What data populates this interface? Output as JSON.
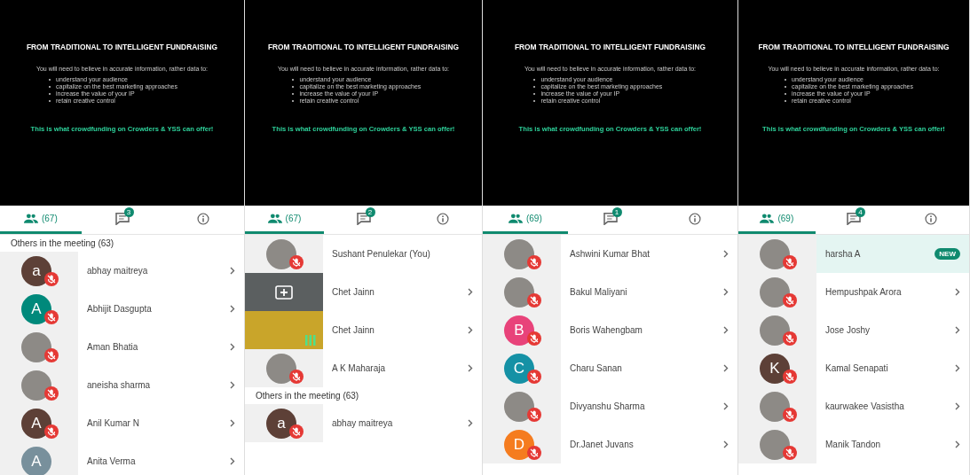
{
  "panels": [
    {
      "slide": {
        "title": "FROM TRADITIONAL TO INTELLIGENT FUNDRAISING",
        "intro": "You will need to believe in accurate information, rather data to:",
        "bullets": [
          "understand your audience",
          "capitalize on the best marketing approaches",
          "increase the value of your IP",
          "retain creative control"
        ],
        "tagline": "This is what crowdfunding on Crowders & YSS can offer!"
      },
      "tabs": [
        {
          "kind": "people",
          "count": "(67)",
          "selected": true
        },
        {
          "kind": "chat",
          "badge": "3",
          "selected": false
        },
        {
          "kind": "info",
          "selected": false
        }
      ],
      "items": [
        {
          "kind": "header",
          "text": "Others in the meeting (63)"
        },
        {
          "kind": "participant",
          "name": "abhay maitreya",
          "avatar": {
            "kind": "letter",
            "letter": "a",
            "color": "#5d4037"
          },
          "muted": true,
          "chevron": true,
          "highlighted": false
        },
        {
          "kind": "participant",
          "name": "Abhijit Dasgupta",
          "avatar": {
            "kind": "letter",
            "letter": "A",
            "color": "#00897b"
          },
          "muted": true,
          "chevron": true,
          "highlighted": false
        },
        {
          "kind": "participant",
          "name": "Aman Bhatia",
          "avatar": {
            "kind": "photo"
          },
          "muted": true,
          "chevron": true,
          "highlighted": false
        },
        {
          "kind": "participant",
          "name": "aneisha sharma",
          "avatar": {
            "kind": "photo"
          },
          "muted": true,
          "chevron": true,
          "highlighted": false
        },
        {
          "kind": "participant",
          "name": "Anil Kumar N",
          "avatar": {
            "kind": "letter",
            "letter": "A",
            "color": "#5d4037"
          },
          "muted": true,
          "chevron": true,
          "highlighted": false
        },
        {
          "kind": "participant",
          "name": "Anita Verma",
          "avatar": {
            "kind": "letter",
            "letter": "A",
            "color": "#78909c"
          },
          "muted": false,
          "chevron": true,
          "highlighted": false
        }
      ]
    },
    {
      "slide": {
        "title": "FROM TRADITIONAL TO INTELLIGENT FUNDRAISING",
        "intro": "You will need to believe in accurate information, rather data to:",
        "bullets": [
          "understand your audience",
          "capitalize on the best marketing approaches",
          "increase the value of your IP",
          "retain creative control"
        ],
        "tagline": "This is what crowdfunding on Crowders & YSS can offer!"
      },
      "tabs": [
        {
          "kind": "people",
          "count": "(67)",
          "selected": true
        },
        {
          "kind": "chat",
          "badge": "2",
          "selected": false
        },
        {
          "kind": "info",
          "selected": false
        }
      ],
      "items": [
        {
          "kind": "participant",
          "name": "Sushant Penulekar (You)",
          "avatar": {
            "kind": "photo"
          },
          "muted": true,
          "chevron": false,
          "highlighted": false
        },
        {
          "kind": "participant",
          "name": "Chet Jainn",
          "avatar": {
            "kind": "screen"
          },
          "muted": false,
          "chevron": true,
          "highlighted": false
        },
        {
          "kind": "participant",
          "name": "Chet Jainn",
          "avatar": {
            "kind": "video"
          },
          "muted": false,
          "chevron": true,
          "highlighted": false
        },
        {
          "kind": "participant",
          "name": "A K Maharaja",
          "avatar": {
            "kind": "photo"
          },
          "muted": true,
          "chevron": true,
          "highlighted": false
        },
        {
          "kind": "header",
          "text": "Others in the meeting (63)"
        },
        {
          "kind": "participant",
          "name": "abhay maitreya",
          "avatar": {
            "kind": "letter",
            "letter": "a",
            "color": "#5d4037"
          },
          "muted": true,
          "chevron": true,
          "highlighted": false
        }
      ]
    },
    {
      "slide": {
        "title": "FROM TRADITIONAL TO INTELLIGENT FUNDRAISING",
        "intro": "You will need to believe in accurate information, rather data to:",
        "bullets": [
          "understand your audience",
          "capitalize on the best marketing approaches",
          "increase the value of your IP",
          "retain creative control"
        ],
        "tagline": "This is what crowdfunding on Crowders & YSS can offer!"
      },
      "tabs": [
        {
          "kind": "people",
          "count": "(69)",
          "selected": true
        },
        {
          "kind": "chat",
          "badge": "1",
          "selected": false
        },
        {
          "kind": "info",
          "selected": false
        }
      ],
      "items": [
        {
          "kind": "participant",
          "name": "Ashwini Kumar Bhat",
          "avatar": {
            "kind": "photo"
          },
          "muted": true,
          "chevron": true,
          "highlighted": false
        },
        {
          "kind": "participant",
          "name": "Bakul Maliyani",
          "avatar": {
            "kind": "photo"
          },
          "muted": true,
          "chevron": true,
          "highlighted": false
        },
        {
          "kind": "participant",
          "name": "Boris Wahengbam",
          "avatar": {
            "kind": "letter",
            "letter": "B",
            "color": "#e8437a"
          },
          "muted": true,
          "chevron": true,
          "highlighted": false
        },
        {
          "kind": "participant",
          "name": "Charu Sanan",
          "avatar": {
            "kind": "letter",
            "letter": "C",
            "color": "#1591a5"
          },
          "muted": true,
          "chevron": true,
          "highlighted": false
        },
        {
          "kind": "participant",
          "name": "Divyanshu Sharma",
          "avatar": {
            "kind": "photo"
          },
          "muted": true,
          "chevron": true,
          "highlighted": false
        },
        {
          "kind": "participant",
          "name": "Dr.Janet Juvans",
          "avatar": {
            "kind": "letter",
            "letter": "D",
            "color": "#f57c1f"
          },
          "muted": true,
          "chevron": true,
          "highlighted": false
        }
      ]
    },
    {
      "slide": {
        "title": "FROM TRADITIONAL TO INTELLIGENT FUNDRAISING",
        "intro": "You will need to believe in accurate information, rather data to:",
        "bullets": [
          "understand your audience",
          "capitalize on the best marketing approaches",
          "increase the value of your IP",
          "retain creative control"
        ],
        "tagline": "This is what crowdfunding on Crowders & YSS can offer!"
      },
      "tabs": [
        {
          "kind": "people",
          "count": "(69)",
          "selected": true
        },
        {
          "kind": "chat",
          "badge": "4",
          "selected": false
        },
        {
          "kind": "info",
          "selected": false
        }
      ],
      "items": [
        {
          "kind": "participant",
          "name": "harsha A",
          "avatar": {
            "kind": "photo"
          },
          "muted": true,
          "chevron": false,
          "highlighted": true,
          "badge": "NEW"
        },
        {
          "kind": "participant",
          "name": "Hempushpak Arora",
          "avatar": {
            "kind": "photo"
          },
          "muted": true,
          "chevron": true,
          "highlighted": false
        },
        {
          "kind": "participant",
          "name": "Jose Joshy",
          "avatar": {
            "kind": "photo"
          },
          "muted": true,
          "chevron": true,
          "highlighted": false
        },
        {
          "kind": "participant",
          "name": "Kamal Senapati",
          "avatar": {
            "kind": "letter",
            "letter": "K",
            "color": "#5d4037"
          },
          "muted": true,
          "chevron": true,
          "highlighted": false
        },
        {
          "kind": "participant",
          "name": "kaurwakee Vasistha",
          "avatar": {
            "kind": "photo"
          },
          "muted": true,
          "chevron": true,
          "highlighted": false
        },
        {
          "kind": "participant",
          "name": "Manik Tandon",
          "avatar": {
            "kind": "photo"
          },
          "muted": true,
          "chevron": true,
          "highlighted": false
        }
      ]
    }
  ]
}
